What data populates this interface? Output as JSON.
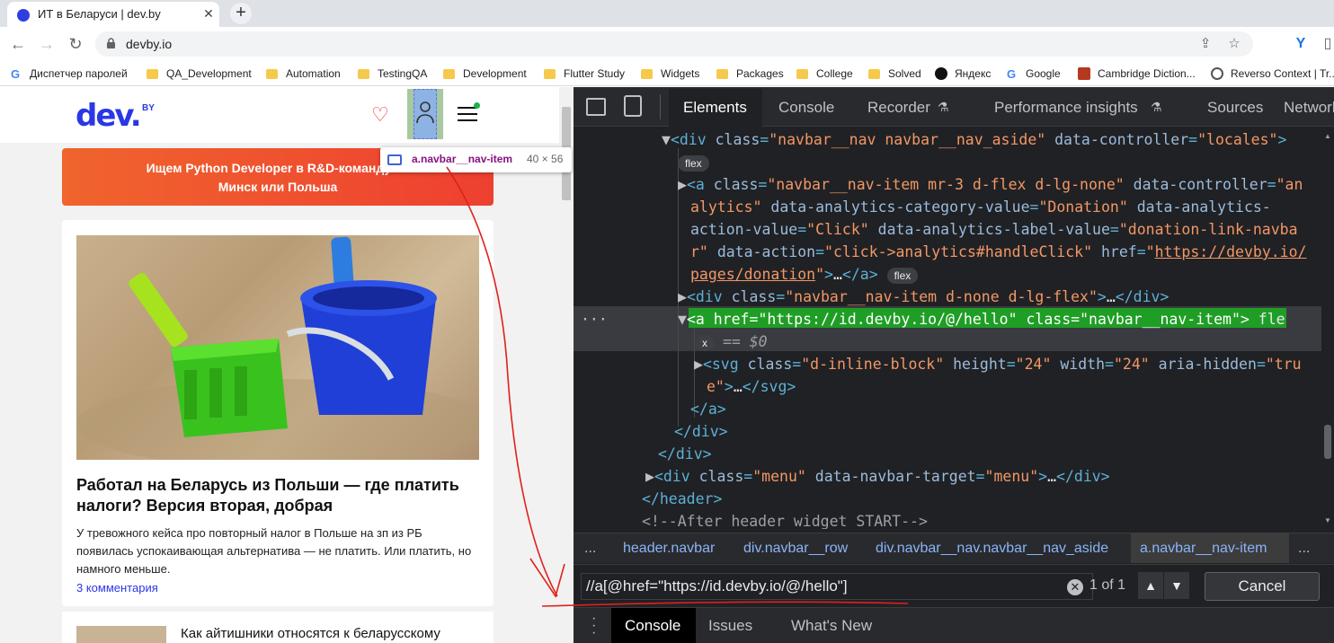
{
  "browser": {
    "tab_title": "ИТ в Беларуси | dev.by",
    "tab_close": "✕",
    "new_tab": "+",
    "url": "devby.io",
    "back": "←",
    "forward": "→",
    "reload": "↻"
  },
  "bookmarks": [
    {
      "label": "Диспетчер паролей",
      "icon": "google-icon"
    },
    {
      "label": "QA_Development",
      "icon": "folder-icon"
    },
    {
      "label": "Automation",
      "icon": "folder-icon"
    },
    {
      "label": "TestingQA",
      "icon": "folder-icon"
    },
    {
      "label": "Development",
      "icon": "folder-icon"
    },
    {
      "label": "Flutter Study",
      "icon": "folder-icon"
    },
    {
      "label": "Widgets",
      "icon": "folder-icon"
    },
    {
      "label": "Packages",
      "icon": "folder-icon"
    },
    {
      "label": "College",
      "icon": "folder-icon"
    },
    {
      "label": "Solved",
      "icon": "folder-icon"
    },
    {
      "label": "Яндекс",
      "icon": "yandex-icon"
    },
    {
      "label": "Google",
      "icon": "google-icon"
    },
    {
      "label": "Cambridge Diction...",
      "icon": "cambridge-icon"
    },
    {
      "label": "Reverso Context | Tr...",
      "icon": "reverso-icon"
    }
  ],
  "site": {
    "logo": "dev.",
    "logo_suffix": "BY",
    "banner_line1": "Ищем Python Developer в R&D-команду Or",
    "banner_line2": "Минск или Польша",
    "tooltip_selector": "a.navbar__nav-item",
    "tooltip_size": "40 × 56",
    "article_title": "Работал на Беларусь из Польши — где платить налоги? Версия вторая, добрая",
    "article_text": "У тревожного кейса про повторный налог в Польше на зп из РБ появилась успокаивающая альтернатива — не платить. Или платить, но намного меньше.",
    "article_comments": "3 комментария",
    "article2_title": "Как айтишники относятся к беларусскому"
  },
  "devtools": {
    "tabs": [
      "Elements",
      "Console",
      "Recorder",
      "Performance insights",
      "Sources",
      "Network"
    ],
    "active_tab": "Elements",
    "breadcrumbs": [
      "header.navbar",
      "div.navbar__row",
      "div.navbar__nav.navbar__nav_aside",
      "a.navbar__nav-item"
    ],
    "crumb_more": "...",
    "search_value": "//a[@href=\"https://id.devby.io/@/hello\"]",
    "search_clear": "✕",
    "match_count": "1 of 1",
    "up": "▲",
    "down": "▼",
    "cancel": "Cancel",
    "drawer_tabs": [
      "Console",
      "Issues",
      "What's New"
    ],
    "code": {
      "l1_tag": "div",
      "l1_a1": "class",
      "l1_v1": "\"navbar__nav navbar__nav_aside\"",
      "l1_a2": "data-controller",
      "l1_v2": "\"locales\"",
      "badge_flex": "flex",
      "l3_class": "\"navbar__nav-item mr-3 d-flex d-lg-none\"",
      "l3_ctrl": "\"an",
      "l4_ctrl": "alytics\"",
      "l4_cat": "\"Donation\"",
      "l5_act": "\"Click\"",
      "l5_lbl": "\"donation-link-navba",
      "l6_lbl": "r\"",
      "l6_action": "\"click->analytics#handleClick\"",
      "l6_href": "https://devby.io/",
      "l7_href": "pages/donation",
      "l8_class": "\"navbar__nav-item d-none d-lg-flex\"",
      "l9_href": "\"https://id.devby.io/@/hello\"",
      "l9_class": "\"navbar__nav-item\"",
      "l9_tail": "fle",
      "l10_badge": "x",
      "l10_eq": "== $0",
      "l11_class": "\"d-inline-block\"",
      "l11_h": "\"24\"",
      "l11_w": "\"24\"",
      "l11_aria": "\"tru",
      "l12": "e\"",
      "menu_class": "\"menu\"",
      "menu_target": "\"menu\"",
      "comment": "<!--After header widget START-->"
    }
  },
  "colors": {
    "brand": "#2a37e6",
    "devtools_bg": "#202124",
    "highlight": "#1f9e25",
    "annotation": "#e0201c"
  }
}
